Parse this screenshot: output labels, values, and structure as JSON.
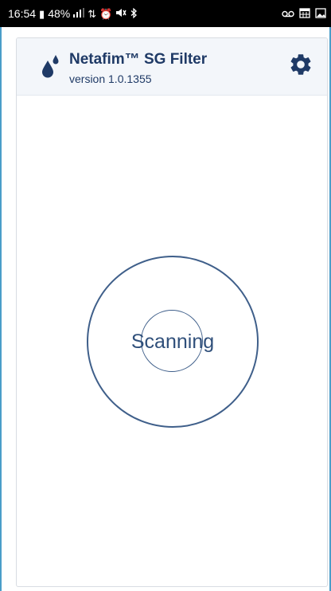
{
  "status_bar": {
    "time": "16:54",
    "battery": "48%",
    "icons": [
      "battery-icon",
      "signal-icon",
      "data-icon",
      "alarm-icon",
      "mute-icon",
      "bluetooth-icon",
      "voicemail-icon",
      "calendar-icon",
      "image-icon"
    ]
  },
  "header": {
    "title": "Netafim™ SG Filter",
    "version": "version 1.0.1355",
    "logo_icon": "water-drops-icon",
    "settings_icon": "gear-icon"
  },
  "scanner": {
    "label": "Scanning"
  },
  "colors": {
    "accent": "#1f3a66",
    "ring": "#3f5f8a",
    "header_bg": "#f3f6fa",
    "frame_border": "#4a9dc9"
  }
}
